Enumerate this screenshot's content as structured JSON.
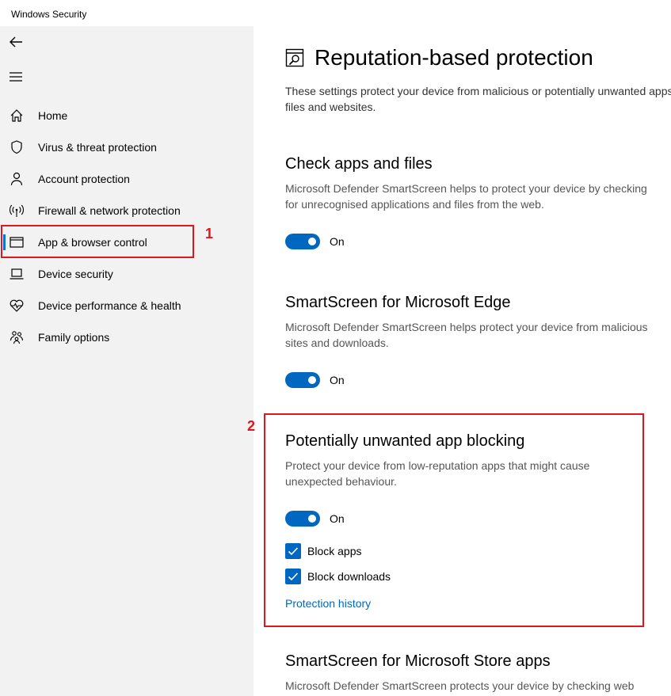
{
  "window": {
    "title": "Windows Security"
  },
  "sidebar": {
    "items": [
      {
        "label": "Home",
        "icon": "home-icon"
      },
      {
        "label": "Virus & threat protection",
        "icon": "shield-icon"
      },
      {
        "label": "Account protection",
        "icon": "person-icon"
      },
      {
        "label": "Firewall & network protection",
        "icon": "wifi-antenna-icon"
      },
      {
        "label": "App & browser control",
        "icon": "app-window-icon",
        "selected": true
      },
      {
        "label": "Device security",
        "icon": "laptop-icon"
      },
      {
        "label": "Device performance & health",
        "icon": "heart-pulse-icon"
      },
      {
        "label": "Family options",
        "icon": "family-icon"
      }
    ]
  },
  "annotations": {
    "one": "1",
    "two": "2"
  },
  "page": {
    "title": "Reputation-based protection",
    "description": "These settings protect your device from malicious or potentially unwanted apps, files and websites."
  },
  "sections": {
    "check_apps": {
      "title": "Check apps and files",
      "description_line1": "Microsoft Defender SmartScreen helps to protect your device by checking",
      "description_line2": "for unrecognised applications and files from the web.",
      "toggle_state": "On"
    },
    "edge": {
      "title": "SmartScreen for Microsoft Edge",
      "description_line1": "Microsoft Defender SmartScreen helps protect your device from malicious",
      "description_line2": "sites and downloads.",
      "toggle_state": "On"
    },
    "pua": {
      "title": "Potentially unwanted app blocking",
      "description_line1": "Protect your device from low-reputation apps that might cause",
      "description_line2": "unexpected behaviour.",
      "toggle_state": "On",
      "block_apps_label": "Block apps",
      "block_downloads_label": "Block downloads",
      "history_link": "Protection history"
    },
    "store": {
      "title": "SmartScreen for Microsoft Store apps",
      "description_line1": "Microsoft Defender SmartScreen protects your device by checking web"
    }
  },
  "colors": {
    "accent": "#0067c0",
    "annotation": "#e0161f",
    "sidebar_bg": "#f2f2f2"
  }
}
